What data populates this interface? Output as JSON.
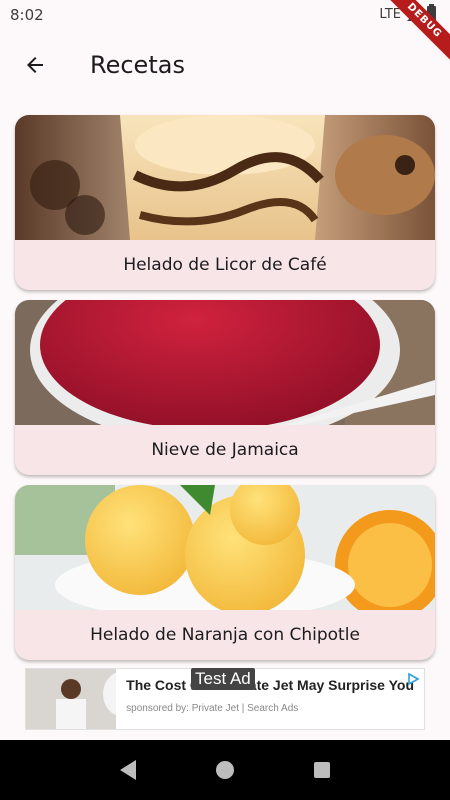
{
  "status_bar": {
    "time": "8:02",
    "network": "LTE"
  },
  "debug_banner": "DEBUG",
  "app_bar": {
    "title": "Recetas",
    "back_icon": "arrow-back-icon"
  },
  "recipes": [
    {
      "title": "Helado de Licor de Café",
      "image": "coffee-liqueur-ice-cream-photo"
    },
    {
      "title": "Nieve de Jamaica",
      "image": "hibiscus-sorbet-photo"
    },
    {
      "title": "Helado de Naranja con Chipotle",
      "image": "orange-chipotle-ice-cream-photo"
    }
  ],
  "ad": {
    "label": "Test Ad",
    "headline": "The Cost Of A Private Jet May Surprise You",
    "sponsor": "sponsored by: Private Jet | Search Ads"
  },
  "colors": {
    "background": "#fdf8f9",
    "card_label_bg": "#f7e5e8",
    "debug_ribbon": "#b71c1c"
  }
}
